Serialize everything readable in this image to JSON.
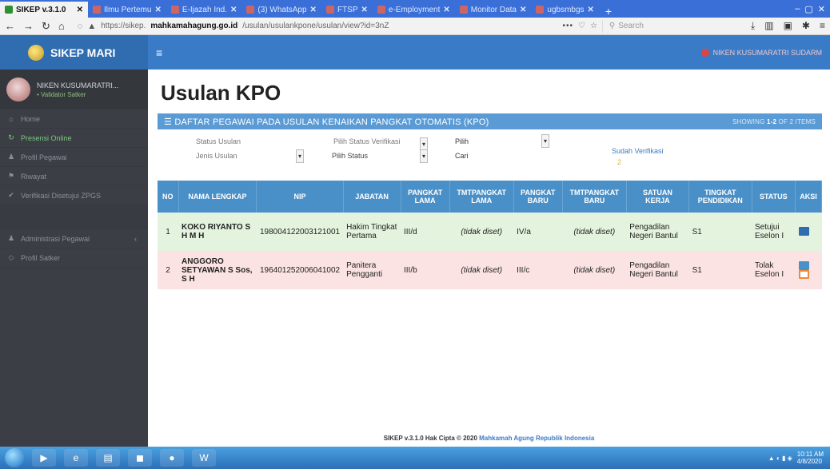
{
  "browser": {
    "tabs": [
      {
        "label": "SIKEP v.3.1.0",
        "active": true
      },
      {
        "label": "Ilmu Pertemu",
        "active": false
      },
      {
        "label": "E-Ijazah Ind.",
        "active": false
      },
      {
        "label": "(3) WhatsApp",
        "active": false
      },
      {
        "label": "FTSP",
        "active": false
      },
      {
        "label": "e-Employment",
        "active": false
      },
      {
        "label": "Monitor Data",
        "active": false
      },
      {
        "label": "ugbsmbgs",
        "active": false
      }
    ],
    "url_prefix": "https://sikep.",
    "url_domain": "mahkamahagung.go.id",
    "url_rest": "/usulan/usulankpone/usulan/view?id=3nZ",
    "search_placeholder": "Search"
  },
  "sidebar": {
    "brand": "SIKEP MARI",
    "user_name": "NIKEN KUSUMARATRI...",
    "user_status": "• Validator Satker",
    "items": [
      {
        "label": "Home",
        "icon": "home-icon",
        "glyph": "⌂",
        "active": false,
        "chevron": false
      },
      {
        "label": "Presensi Online",
        "icon": "refresh-icon",
        "glyph": "↻",
        "active": true,
        "chevron": false
      },
      {
        "label": "Profil Pegawai",
        "icon": "user-icon",
        "glyph": "♟",
        "active": false,
        "chevron": false
      },
      {
        "label": "Riwayat",
        "icon": "history-icon",
        "glyph": "⚑",
        "active": false,
        "chevron": false
      },
      {
        "label": "Verifikasi Disetujui ZPGS",
        "icon": "check-icon",
        "glyph": "✔",
        "active": false,
        "chevron": false
      },
      {
        "label": "",
        "icon": "",
        "glyph": "",
        "active": false,
        "chevron": false,
        "separator": true
      },
      {
        "label": "Administrasi Pegawai",
        "icon": "users-icon",
        "glyph": "♟",
        "active": false,
        "chevron": true
      },
      {
        "label": "Profil Satker",
        "icon": "building-icon",
        "glyph": "◇",
        "active": false,
        "chevron": false
      }
    ]
  },
  "header": {
    "user": "NIKEN KUSUMARATRI SUDARM"
  },
  "main": {
    "title": "Usulan KPO",
    "panel_title": "☰ DAFTAR PEGAWAI PADA USULAN KENAIKAN PANGKAT OTOMATIS (KPO)",
    "showing_prefix": "SHOWING",
    "showing_range": "1-2",
    "showing_suffix": "OF 2 ITEMS",
    "filters": {
      "f1": "Status Usulan",
      "f2": "Jenis Usulan",
      "f3": "Pilih Status Verifikasi",
      "select1_value": "Pilih",
      "f4": "Pilih Status",
      "select2_value": "Cari",
      "verified_label": "Sudah Verifikasi",
      "verified_count": "2"
    },
    "columns": [
      "NO",
      "NAMA LENGKAP",
      "NIP",
      "JABATAN",
      "PANGKAT LAMA",
      "TMTPANGKAT LAMA",
      "PANGKAT BARU",
      "TMTPANGKAT BARU",
      "SATUAN KERJA",
      "TINGKAT PENDIDIKAN",
      "STATUS",
      "AKSI"
    ],
    "rows": [
      {
        "no": "1",
        "nama": "KOKO RIYANTO S H M H",
        "nip": "198004122003121001",
        "jabatan": "Hakim Tingkat Pertama",
        "pangkat_lama": "III/d",
        "tmt_lama": "(tidak diset)",
        "pangkat_baru": "IV/a",
        "tmt_baru": "(tidak diset)",
        "satuan_kerja": "Pengadilan Negeri Bantul",
        "pendidikan": "S1",
        "status": "Setujui Eselon I",
        "tone": "green"
      },
      {
        "no": "2",
        "nama": "ANGGORO SETYAWAN S Sos, S H",
        "nip": "196401252006041002",
        "jabatan": "Panitera Pengganti",
        "pangkat_lama": "III/b",
        "tmt_lama": "(tidak diset)",
        "pangkat_baru": "III/c",
        "tmt_baru": "(tidak diset)",
        "satuan_kerja": "Pengadilan Negeri Bantul",
        "pendidikan": "S1",
        "status": "Tolak Eselon I",
        "tone": "red"
      }
    ]
  },
  "footer": {
    "prefix": "SIKEP v.3.1.0 Hak Cipta © 2020 ",
    "link": "Mahkamah Agung Republik Indonesia"
  },
  "taskbar": {
    "time": "10:11 AM",
    "date": "4/8/2020"
  },
  "colors": {
    "brand": "#2f6db0",
    "header": "#3a7bc8",
    "table_head": "#4a90c8",
    "row_approve": "#e3f3dd",
    "row_reject": "#fbe3e3"
  }
}
